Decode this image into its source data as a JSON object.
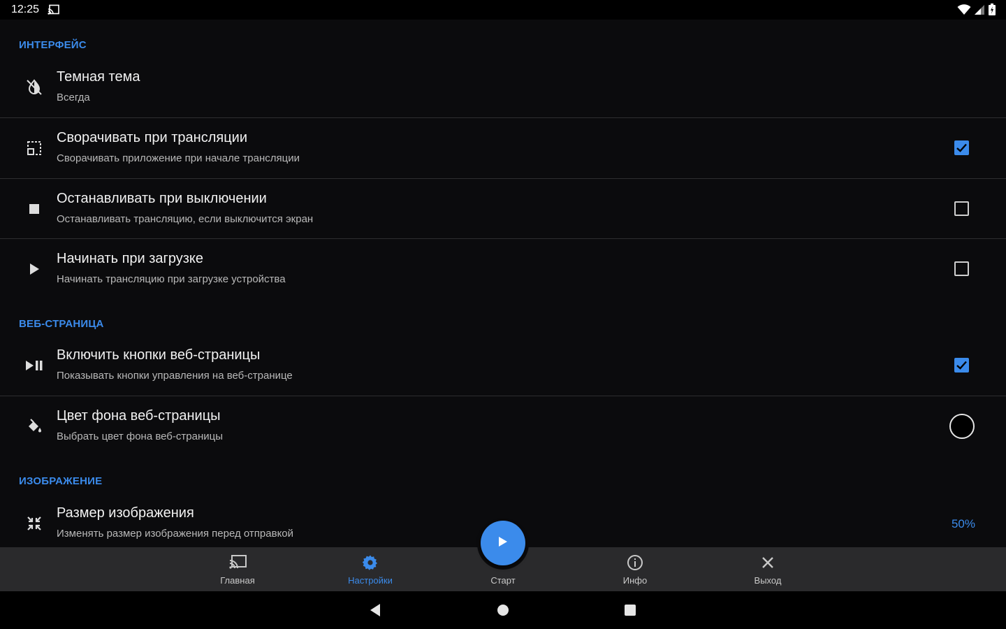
{
  "status_bar": {
    "time": "12:25",
    "icons": [
      "cast-icon",
      "wifi-icon",
      "signal-icon",
      "battery-icon"
    ]
  },
  "sections": {
    "interface": "ИНТЕРФЕЙС",
    "webpage": "ВЕБ-СТРАНИЦА",
    "image": "ИЗОБРАЖЕНИЕ"
  },
  "settings": {
    "dark_theme": {
      "title": "Темная тема",
      "summary": "Всегда",
      "icon": "invert-colors-icon"
    },
    "minimize": {
      "title": "Сворачивать при трансляции",
      "summary": "Сворачивать приложение при начале трансляции",
      "checked": true,
      "icon": "minimize-icon"
    },
    "stop_on_off": {
      "title": "Останавливать при выключении",
      "summary": "Останавливать трансляцию, если выключится экран",
      "checked": false,
      "icon": "stop-icon"
    },
    "start_on_boot": {
      "title": "Начинать при загрузке",
      "summary": "Начинать трансляцию при загрузке устройства",
      "checked": false,
      "icon": "play-icon"
    },
    "web_buttons": {
      "title": "Включить кнопки веб-страницы",
      "summary": "Показывать кнопки управления на веб-странице",
      "checked": true,
      "icon": "play-pause-icon"
    },
    "web_bg_color": {
      "title": "Цвет фона веб-страницы",
      "summary": "Выбрать цвет фона веб-страницы",
      "color": "#000000",
      "icon": "paint-bucket-icon"
    },
    "image_size": {
      "title": "Размер изображения",
      "summary": "Изменять размер изображения перед отправкой",
      "value": "50%",
      "icon": "resize-icon"
    }
  },
  "bottom_nav": {
    "home": "Главная",
    "settings": "Настройки",
    "start": "Старт",
    "info": "Инфо",
    "exit": "Выход",
    "active": "settings"
  },
  "colors": {
    "accent": "#3b8beb",
    "background": "#0b0b0d",
    "bottom_bar": "#2a2a2c"
  }
}
